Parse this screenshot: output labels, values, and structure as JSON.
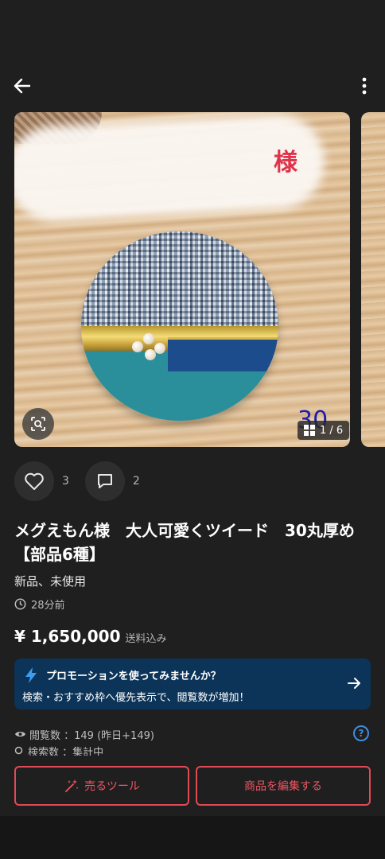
{
  "topbar": {
    "back_icon": "arrow-left-icon",
    "more_icon": "more-vertical-icon"
  },
  "gallery": {
    "photo_number_text": "30",
    "counter": "1 / 6",
    "current": 1,
    "total": 6
  },
  "actions": {
    "likes": "3",
    "comments": "2"
  },
  "item": {
    "title": "メグえもん様　大人可愛くツイード　30丸厚め【部品6種】",
    "condition": "新品、未使用",
    "time": "28分前",
    "price": "¥ 1,650,000",
    "tax_note": "送料込み"
  },
  "promo": {
    "title": "プロモーションを使ってみませんか？",
    "description": "検索・おすすめ枠へ優先表示で、閲覧数が増加！"
  },
  "stats": {
    "views": "閲覧数 ：149 (昨日+149)",
    "search_partial": "検索数 ：集計中"
  },
  "bottom": {
    "sell_tools": "売るツール",
    "edit_item": "商品を編集する"
  },
  "colors": {
    "background": "#1f1f1f",
    "promo_bg": "#0c3459",
    "accent_red": "#e04a55",
    "help_blue": "#3d8ee0"
  }
}
